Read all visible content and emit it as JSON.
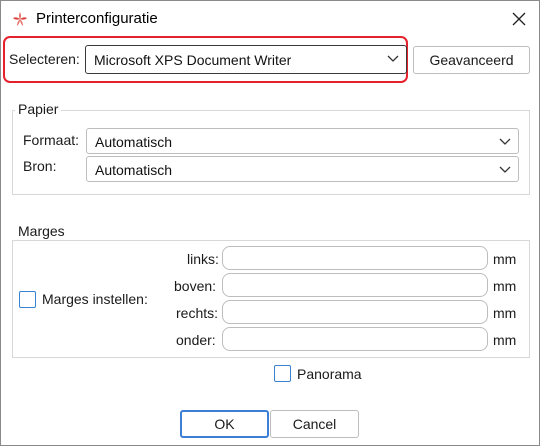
{
  "window": {
    "title": "Printerconfiguratie"
  },
  "printer": {
    "label": "Selecteren:",
    "selected": "Microsoft XPS Document Writer",
    "advanced_button": "Geavanceerd"
  },
  "paper": {
    "group_label": "Papier",
    "format_label": "Formaat:",
    "format_value": "Automatisch",
    "source_label": "Bron:",
    "source_value": "Automatisch"
  },
  "margins": {
    "group_label": "Marges",
    "checkbox_label": "Marges instellen:",
    "fields": [
      {
        "label": "links:",
        "value": "",
        "unit": "mm"
      },
      {
        "label": "boven:",
        "value": "",
        "unit": "mm"
      },
      {
        "label": "rechts:",
        "value": "",
        "unit": "mm"
      },
      {
        "label": "onder:",
        "value": "",
        "unit": "mm"
      }
    ]
  },
  "panorama": {
    "label": "Panorama"
  },
  "footer": {
    "ok": "OK",
    "cancel": "Cancel"
  },
  "colors": {
    "highlight": "#e5212b",
    "checkbox": "#3b82d0",
    "default_button_border": "#3b7fd6",
    "app_icon": "#d9413a"
  },
  "icons": {
    "app": "app-logo-icon",
    "close": "close-icon",
    "dropdown": "chevron-down-icon"
  }
}
